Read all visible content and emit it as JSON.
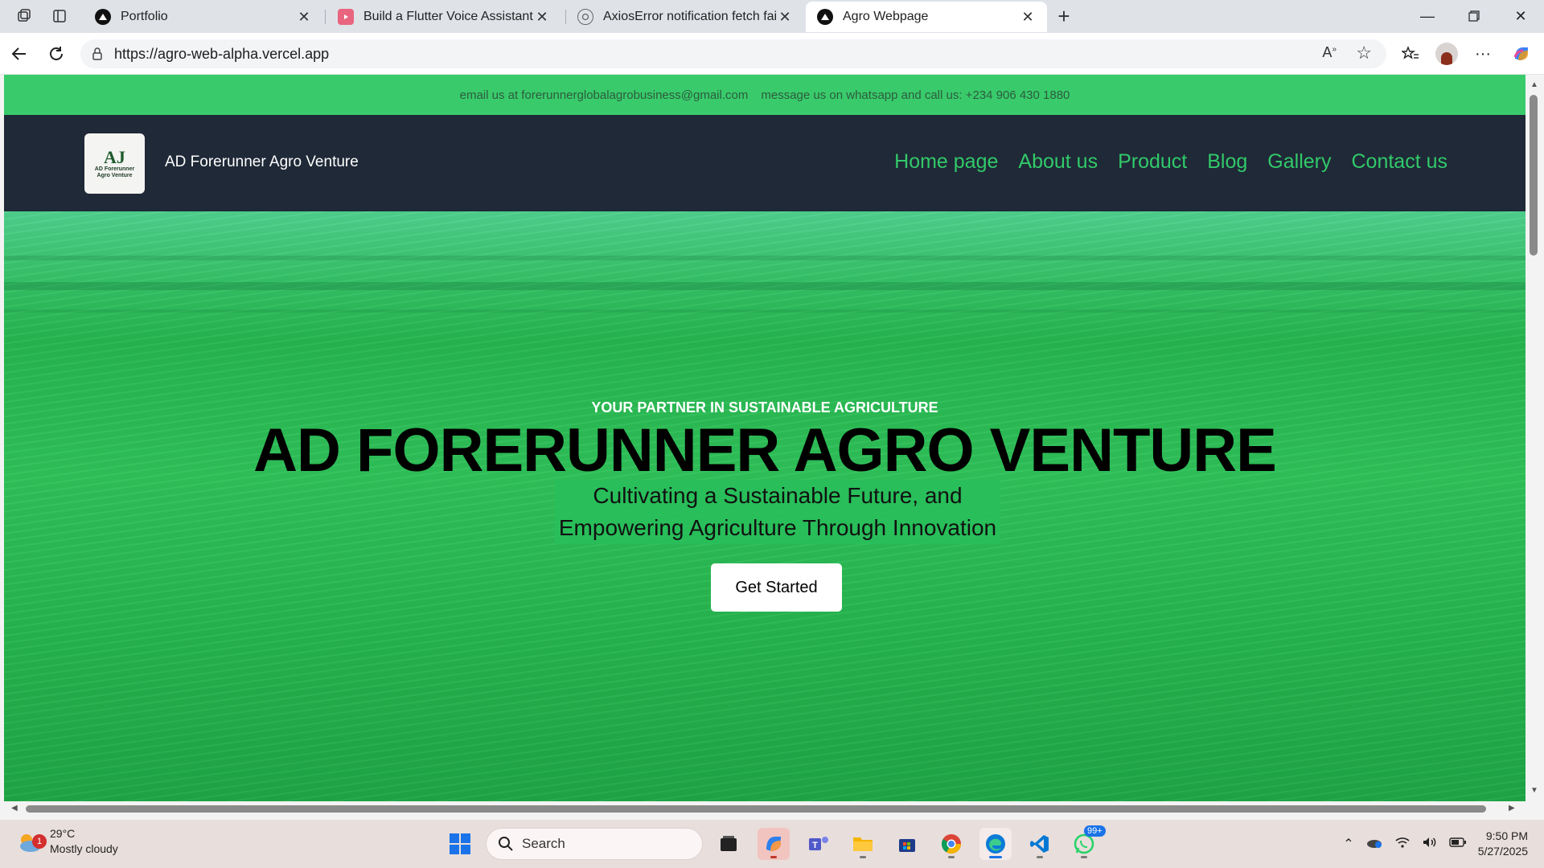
{
  "browser": {
    "tabs": [
      {
        "title": "Portfolio",
        "icon": "vercel-triangle-icon"
      },
      {
        "title": "Build a Flutter Voice Assistant Ap",
        "icon": "youtube-icon"
      },
      {
        "title": "AxiosError notification fetch fail",
        "icon": "openai-icon"
      },
      {
        "title": "Agro Webpage",
        "icon": "vercel-triangle-icon",
        "active": true
      }
    ],
    "url": "https://agro-web-alpha.vercel.app"
  },
  "site": {
    "topbar": {
      "email_text": "email us at forerunnerglobalagrobusiness@gmail.com",
      "phone_text": "message us on whatsapp and call us: +234 906 430 1880"
    },
    "logo": {
      "mark": "AJ",
      "line1": "AD Forerunner",
      "line2": "Agro Venture"
    },
    "brand_name": "AD Forerunner Agro Venture",
    "nav": [
      "Home page",
      "About us",
      "Product",
      "Blog",
      "Gallery",
      "Contact us"
    ],
    "hero": {
      "eyebrow": "YOUR PARTNER IN SUSTAINABLE AGRICULTURE",
      "title": "AD FORERUNNER AGRO VENTURE",
      "subtitle_line1": "Cultivating a Sustainable Future, and",
      "subtitle_line2": "Empowering Agriculture Through Innovation",
      "cta": "Get Started"
    },
    "colors": {
      "accent": "#39cb6b",
      "header_bg": "#1f2937",
      "nav_link": "#32c96a"
    }
  },
  "taskbar": {
    "weather": {
      "temp": "29°C",
      "condition": "Mostly cloudy",
      "badge": "1"
    },
    "search_label": "Search",
    "whatsapp_badge": "99+",
    "time": "9:50 PM",
    "date": "5/27/2025"
  }
}
